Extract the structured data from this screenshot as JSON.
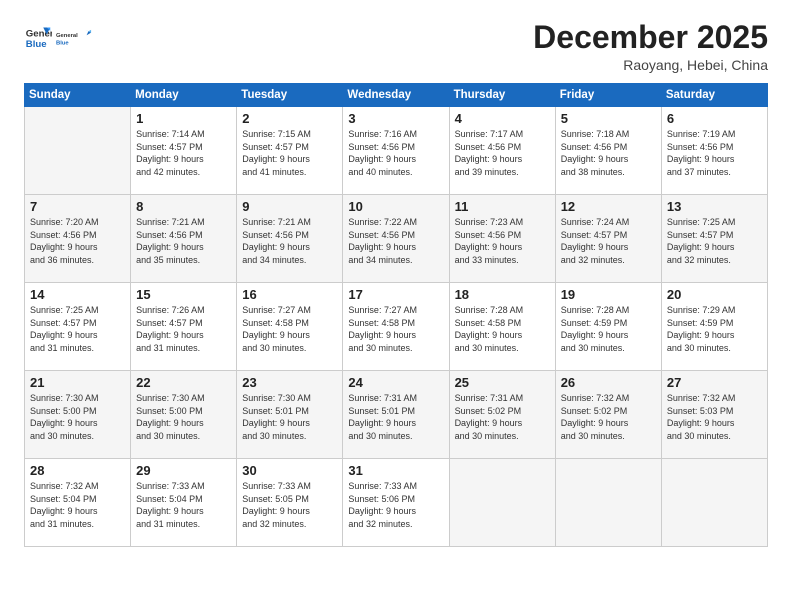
{
  "logo": {
    "line1": "General",
    "line2": "Blue"
  },
  "title": "December 2025",
  "subtitle": "Raoyang, Hebei, China",
  "days_of_week": [
    "Sunday",
    "Monday",
    "Tuesday",
    "Wednesday",
    "Thursday",
    "Friday",
    "Saturday"
  ],
  "weeks": [
    [
      {
        "day": "",
        "info": ""
      },
      {
        "day": "1",
        "info": "Sunrise: 7:14 AM\nSunset: 4:57 PM\nDaylight: 9 hours\nand 42 minutes."
      },
      {
        "day": "2",
        "info": "Sunrise: 7:15 AM\nSunset: 4:57 PM\nDaylight: 9 hours\nand 41 minutes."
      },
      {
        "day": "3",
        "info": "Sunrise: 7:16 AM\nSunset: 4:56 PM\nDaylight: 9 hours\nand 40 minutes."
      },
      {
        "day": "4",
        "info": "Sunrise: 7:17 AM\nSunset: 4:56 PM\nDaylight: 9 hours\nand 39 minutes."
      },
      {
        "day": "5",
        "info": "Sunrise: 7:18 AM\nSunset: 4:56 PM\nDaylight: 9 hours\nand 38 minutes."
      },
      {
        "day": "6",
        "info": "Sunrise: 7:19 AM\nSunset: 4:56 PM\nDaylight: 9 hours\nand 37 minutes."
      }
    ],
    [
      {
        "day": "7",
        "info": "Sunrise: 7:20 AM\nSunset: 4:56 PM\nDaylight: 9 hours\nand 36 minutes."
      },
      {
        "day": "8",
        "info": "Sunrise: 7:21 AM\nSunset: 4:56 PM\nDaylight: 9 hours\nand 35 minutes."
      },
      {
        "day": "9",
        "info": "Sunrise: 7:21 AM\nSunset: 4:56 PM\nDaylight: 9 hours\nand 34 minutes."
      },
      {
        "day": "10",
        "info": "Sunrise: 7:22 AM\nSunset: 4:56 PM\nDaylight: 9 hours\nand 34 minutes."
      },
      {
        "day": "11",
        "info": "Sunrise: 7:23 AM\nSunset: 4:56 PM\nDaylight: 9 hours\nand 33 minutes."
      },
      {
        "day": "12",
        "info": "Sunrise: 7:24 AM\nSunset: 4:57 PM\nDaylight: 9 hours\nand 32 minutes."
      },
      {
        "day": "13",
        "info": "Sunrise: 7:25 AM\nSunset: 4:57 PM\nDaylight: 9 hours\nand 32 minutes."
      }
    ],
    [
      {
        "day": "14",
        "info": "Sunrise: 7:25 AM\nSunset: 4:57 PM\nDaylight: 9 hours\nand 31 minutes."
      },
      {
        "day": "15",
        "info": "Sunrise: 7:26 AM\nSunset: 4:57 PM\nDaylight: 9 hours\nand 31 minutes."
      },
      {
        "day": "16",
        "info": "Sunrise: 7:27 AM\nSunset: 4:58 PM\nDaylight: 9 hours\nand 30 minutes."
      },
      {
        "day": "17",
        "info": "Sunrise: 7:27 AM\nSunset: 4:58 PM\nDaylight: 9 hours\nand 30 minutes."
      },
      {
        "day": "18",
        "info": "Sunrise: 7:28 AM\nSunset: 4:58 PM\nDaylight: 9 hours\nand 30 minutes."
      },
      {
        "day": "19",
        "info": "Sunrise: 7:28 AM\nSunset: 4:59 PM\nDaylight: 9 hours\nand 30 minutes."
      },
      {
        "day": "20",
        "info": "Sunrise: 7:29 AM\nSunset: 4:59 PM\nDaylight: 9 hours\nand 30 minutes."
      }
    ],
    [
      {
        "day": "21",
        "info": "Sunrise: 7:30 AM\nSunset: 5:00 PM\nDaylight: 9 hours\nand 30 minutes."
      },
      {
        "day": "22",
        "info": "Sunrise: 7:30 AM\nSunset: 5:00 PM\nDaylight: 9 hours\nand 30 minutes."
      },
      {
        "day": "23",
        "info": "Sunrise: 7:30 AM\nSunset: 5:01 PM\nDaylight: 9 hours\nand 30 minutes."
      },
      {
        "day": "24",
        "info": "Sunrise: 7:31 AM\nSunset: 5:01 PM\nDaylight: 9 hours\nand 30 minutes."
      },
      {
        "day": "25",
        "info": "Sunrise: 7:31 AM\nSunset: 5:02 PM\nDaylight: 9 hours\nand 30 minutes."
      },
      {
        "day": "26",
        "info": "Sunrise: 7:32 AM\nSunset: 5:02 PM\nDaylight: 9 hours\nand 30 minutes."
      },
      {
        "day": "27",
        "info": "Sunrise: 7:32 AM\nSunset: 5:03 PM\nDaylight: 9 hours\nand 30 minutes."
      }
    ],
    [
      {
        "day": "28",
        "info": "Sunrise: 7:32 AM\nSunset: 5:04 PM\nDaylight: 9 hours\nand 31 minutes."
      },
      {
        "day": "29",
        "info": "Sunrise: 7:33 AM\nSunset: 5:04 PM\nDaylight: 9 hours\nand 31 minutes."
      },
      {
        "day": "30",
        "info": "Sunrise: 7:33 AM\nSunset: 5:05 PM\nDaylight: 9 hours\nand 32 minutes."
      },
      {
        "day": "31",
        "info": "Sunrise: 7:33 AM\nSunset: 5:06 PM\nDaylight: 9 hours\nand 32 minutes."
      },
      {
        "day": "",
        "info": ""
      },
      {
        "day": "",
        "info": ""
      },
      {
        "day": "",
        "info": ""
      }
    ]
  ]
}
